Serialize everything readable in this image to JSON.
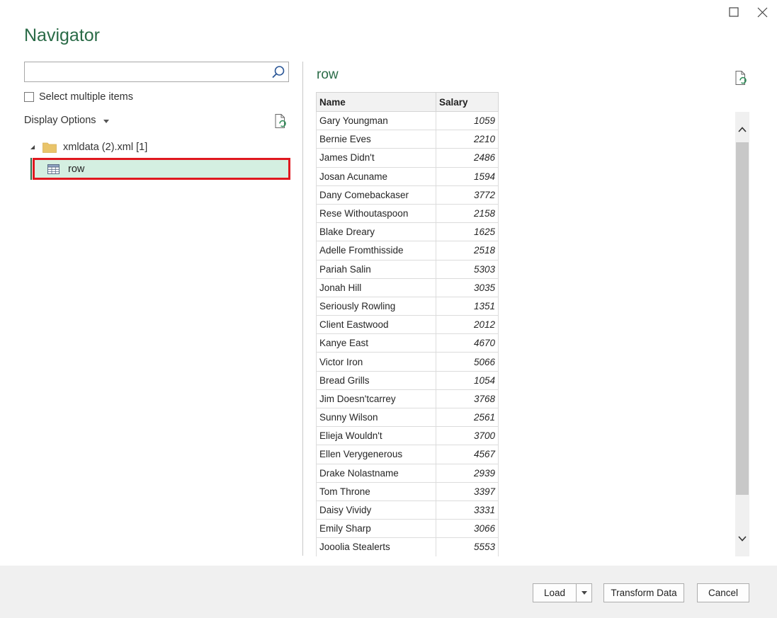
{
  "dialog": {
    "title": "Navigator"
  },
  "left_pane": {
    "search": {
      "value": "",
      "placeholder": ""
    },
    "select_multiple_label": "Select multiple items",
    "display_options_label": "Display Options",
    "tree": {
      "folder_label": "xmldata (2).xml [1]",
      "item_label": "row"
    }
  },
  "preview": {
    "title": "row",
    "columns": [
      "Name",
      "Salary"
    ],
    "rows": [
      [
        "Gary Youngman",
        "1059"
      ],
      [
        "Bernie Eves",
        "2210"
      ],
      [
        "James Didn't",
        "2486"
      ],
      [
        "Josan Acuname",
        "1594"
      ],
      [
        "Dany Comebackaser",
        "3772"
      ],
      [
        "Rese Withoutaspoon",
        "2158"
      ],
      [
        "Blake Dreary",
        "1625"
      ],
      [
        "Adelle Fromthisside",
        "2518"
      ],
      [
        "Pariah Salin",
        "5303"
      ],
      [
        "Jonah Hill",
        "3035"
      ],
      [
        "Seriously Rowling",
        "1351"
      ],
      [
        "Client Eastwood",
        "2012"
      ],
      [
        "Kanye East",
        "4670"
      ],
      [
        "Victor Iron",
        "5066"
      ],
      [
        "Bread Grills",
        "1054"
      ],
      [
        "Jim Doesn'tcarrey",
        "3768"
      ],
      [
        "Sunny Wilson",
        "2561"
      ],
      [
        "Elieja Wouldn't",
        "3700"
      ],
      [
        "Ellen Verygenerous",
        "4567"
      ],
      [
        "Drake Nolastname",
        "2939"
      ],
      [
        "Tom Throne",
        "3397"
      ],
      [
        "Daisy Vividy",
        "3331"
      ],
      [
        "Emily Sharp",
        "3066"
      ],
      [
        "Jooolia Stealerts",
        "5553"
      ]
    ]
  },
  "footer": {
    "load_label": "Load",
    "transform_label": "Transform Data",
    "cancel_label": "Cancel"
  },
  "colors": {
    "accent": "#2a6b47",
    "selection": "#d4efe1",
    "highlight_border": "#e0181f"
  },
  "icons": {
    "maximize": "maximize-icon",
    "close": "close-icon",
    "search": "search-icon",
    "refresh": "refresh-icon",
    "folder": "folder-icon",
    "table": "table-icon"
  }
}
